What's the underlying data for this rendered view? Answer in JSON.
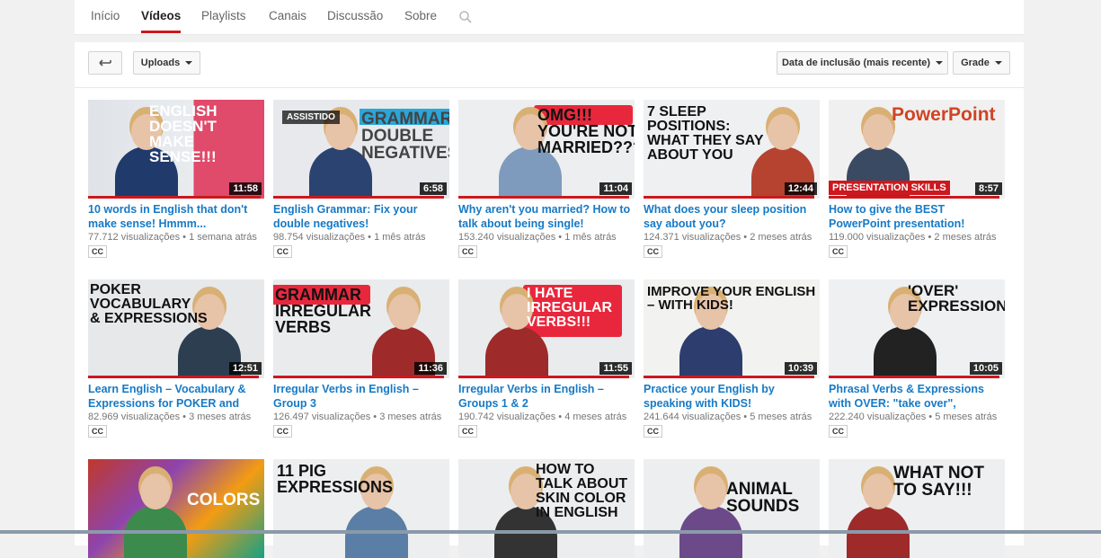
{
  "tabs": [
    {
      "label": "Início"
    },
    {
      "label": "Vídeos"
    },
    {
      "label": "Playlists"
    },
    {
      "label": "Canais"
    },
    {
      "label": "Discussão"
    },
    {
      "label": "Sobre"
    }
  ],
  "toolbar": {
    "uploads_label": "Uploads",
    "sort_label": "Data de inclusão (mais recente)",
    "view_label": "Grade"
  },
  "colors": {
    "accent": "#cc181e",
    "link": "#167ac6",
    "meta": "#767676"
  },
  "videos": [
    {
      "title": "10 words in English that don't make sense! Hmmm...",
      "views": "77.712 visualizações",
      "age": "1 semana atrás",
      "duration": "11:58",
      "cc": "CC",
      "thumb_text": "ENGLISH\nDOESN'T\nMAKE\nSENSE!!!",
      "watched": "",
      "progress": 0.98
    },
    {
      "title": "English Grammar: Fix your double negatives!",
      "views": "98.754 visualizações",
      "age": "1 mês atrás",
      "duration": "6:58",
      "cc": "CC",
      "thumb_text": "GRAMMAR\nDOUBLE\nNEGATIVES",
      "watched": "ASSISTIDO",
      "progress": 0.97
    },
    {
      "title": "Why aren't you married? How to talk about being single!",
      "views": "153.240 visualizações",
      "age": "1 mês atrás",
      "duration": "11:04",
      "cc": "CC",
      "thumb_text": "OMG!!!\nYOU'RE NOT\nMARRIED???",
      "watched": "",
      "progress": 0.97
    },
    {
      "title": "What does your sleep position say about you?",
      "views": "124.371 visualizações",
      "age": "2 meses atrás",
      "duration": "12:44",
      "cc": "CC",
      "thumb_text": "7 SLEEP\nPOSITIONS:\nWHAT THEY SAY\nABOUT YOU",
      "watched": "",
      "progress": 0.97
    },
    {
      "title": "How to give the BEST PowerPoint presentation!",
      "views": "119.000 visualizações",
      "age": "2 meses atrás",
      "duration": "8:57",
      "cc": "CC",
      "thumb_text": "PowerPoint",
      "thumb_sub": "PRESENTATION SKILLS",
      "watched": "",
      "progress": 0.97
    },
    {
      "title": "Learn English – Vocabulary & Expressions for POKER and oth...",
      "views": "82.969 visualizações",
      "age": "3 meses atrás",
      "duration": "12:51",
      "cc": "CC",
      "thumb_text": "POKER\nVOCABULARY\n& EXPRESSIONS",
      "watched": "",
      "progress": 0.97
    },
    {
      "title": "Irregular Verbs in English – Group 3",
      "views": "126.497 visualizações",
      "age": "3 meses atrás",
      "duration": "11:36",
      "cc": "CC",
      "thumb_text": "GRAMMAR\nIRREGULAR\nVERBS",
      "watched": "",
      "progress": 0.97
    },
    {
      "title": "Irregular Verbs in English – Groups 1 & 2",
      "views": "190.742 visualizações",
      "age": "4 meses atrás",
      "duration": "11:55",
      "cc": "CC",
      "thumb_text": "I HATE\nIRREGULAR\nVERBS!!!",
      "watched": "",
      "progress": 0.97
    },
    {
      "title": "Practice your English by speaking with KIDS!",
      "views": "241.644 visualizações",
      "age": "5 meses atrás",
      "duration": "10:39",
      "cc": "CC",
      "thumb_text": "IMPROVE YOUR ENGLISH\n– WITH KIDS!",
      "watched": "",
      "progress": 0.97
    },
    {
      "title": "Phrasal Verbs & Expressions with OVER: \"take over\", \"overplayed\",...",
      "views": "222.240 visualizações",
      "age": "5 meses atrás",
      "duration": "10:05",
      "cc": "CC",
      "thumb_text": "'OVER'\nEXPRESSIONS",
      "watched": "",
      "progress": 0.97
    },
    {
      "title": "",
      "views": "",
      "age": "",
      "duration": "",
      "cc": "",
      "thumb_text": "COLORS",
      "watched": "",
      "progress": 0
    },
    {
      "title": "",
      "views": "",
      "age": "",
      "duration": "",
      "cc": "",
      "thumb_text": "11 PIG\nEXPRESSIONS",
      "watched": "",
      "progress": 0
    },
    {
      "title": "",
      "views": "",
      "age": "",
      "duration": "",
      "cc": "",
      "thumb_text": "HOW TO\nTALK ABOUT\nSKIN COLOR\nIN ENGLISH",
      "watched": "",
      "progress": 0
    },
    {
      "title": "",
      "views": "",
      "age": "",
      "duration": "",
      "cc": "",
      "thumb_text": "ANIMAL\nSOUNDS",
      "watched": "",
      "progress": 0
    },
    {
      "title": "",
      "views": "",
      "age": "",
      "duration": "",
      "cc": "",
      "thumb_text": "WHAT NOT\nTO SAY!!!",
      "watched": "",
      "progress": 0
    }
  ]
}
